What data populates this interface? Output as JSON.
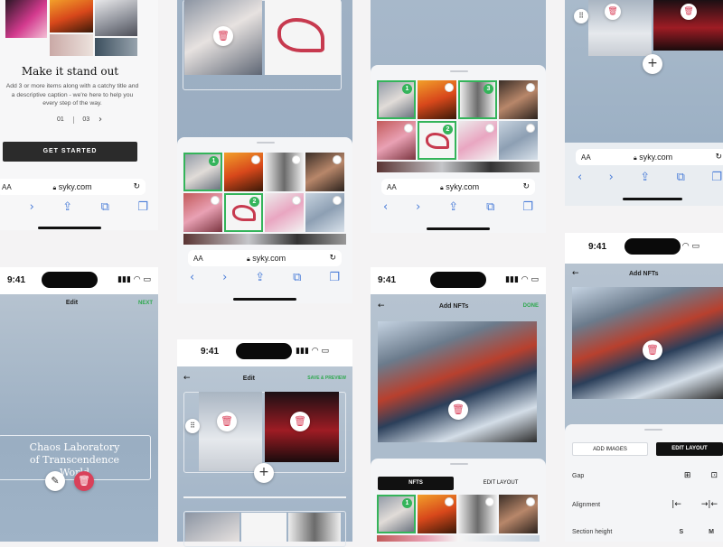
{
  "onboarding": {
    "title": "Make it stand out",
    "body": "Add 3 or more items along with a catchy title and a descriptive caption - we're here to help you every step of the way.",
    "page_current": "01",
    "page_total": "03",
    "cta": "GET STARTED"
  },
  "browser": {
    "aa_label": "AA",
    "url": "syky.com"
  },
  "status": {
    "time": "9:41"
  },
  "edit_screen": {
    "title": "Edit",
    "next": "NEXT",
    "heading": "Chaos Laboratory of Transcendence World"
  },
  "edit_screen2": {
    "title": "Edit",
    "save_preview": "SAVE & PREVIEW"
  },
  "add_nfts": {
    "title": "Add NFTs",
    "done": "DONE",
    "tab_nfts": "NFTS",
    "tab_layout": "EDIT LAYOUT"
  },
  "add_nfts2": {
    "title": "Add NFTs",
    "btn_add_images": "ADD IMAGES",
    "btn_edit_layout": "EDIT LAYOUT",
    "gap_label": "Gap",
    "alignment_label": "Alignment",
    "section_height_label": "Section height",
    "height_s": "S",
    "height_m": "M"
  },
  "selection_numbers": {
    "n1": "1",
    "n2": "2",
    "n3": "3"
  },
  "colors": {
    "green": "#34b45a",
    "accent_blue": "#4a7dd8",
    "dark": "#111111",
    "bluegray": "#9fb1c4"
  },
  "icons": [
    "reload-icon",
    "back-icon",
    "forward-icon",
    "share-icon",
    "bookmarks-icon",
    "tabs-icon",
    "lock-icon",
    "trash-icon",
    "plus-icon",
    "pencil-icon",
    "drag-icon",
    "signal-icon",
    "wifi-icon",
    "battery-icon"
  ]
}
